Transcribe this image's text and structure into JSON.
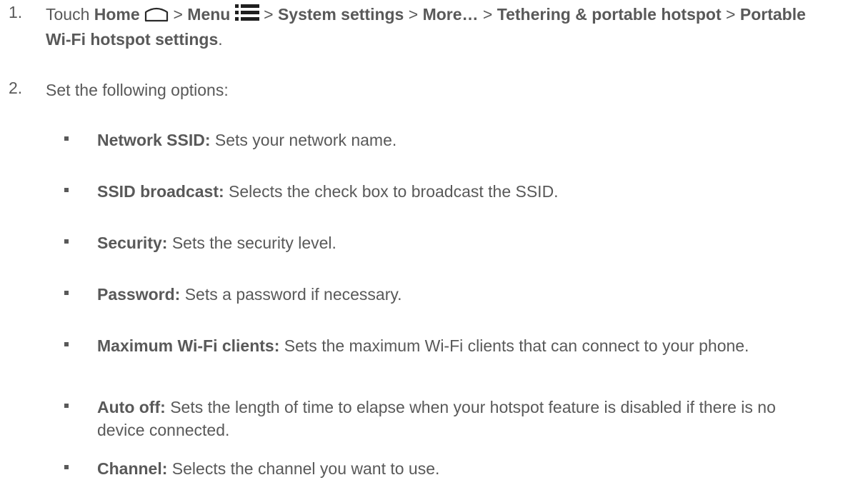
{
  "steps": [
    {
      "number": "1.",
      "touch": "Touch",
      "home": "Home",
      "home_icon": "home-icon",
      "sep1": ">",
      "menu": "Menu",
      "menu_icon": "menu-icon",
      "sep2": ">",
      "system_settings": "System settings",
      "sep3": ">",
      "more": "More…",
      "sep4": ">",
      "tethering": "Tethering & portable hotspot",
      "sep5": ">",
      "portable_settings": "Portable Wi-Fi hotspot settings",
      "end": "."
    },
    {
      "number": "2.",
      "text": "Set the following options:"
    }
  ],
  "options": [
    {
      "term": "Network SSID:",
      "desc": "Sets your network name."
    },
    {
      "term": "SSID broadcast:",
      "desc": "Selects the check box to broadcast the SSID."
    },
    {
      "term": "Security:",
      "desc": "Sets the security level."
    },
    {
      "term": "Password:",
      "desc": "Sets a password if necessary."
    },
    {
      "term": "Maximum Wi-Fi clients:",
      "desc": "Sets the maximum Wi-Fi clients that can connect to your phone."
    },
    {
      "term": "Auto off:",
      "desc": "Sets the length of time to elapse when your hotspot feature is disabled if there is no device connected."
    },
    {
      "term": "Channel:",
      "desc": "Selects the channel you want to use."
    }
  ]
}
